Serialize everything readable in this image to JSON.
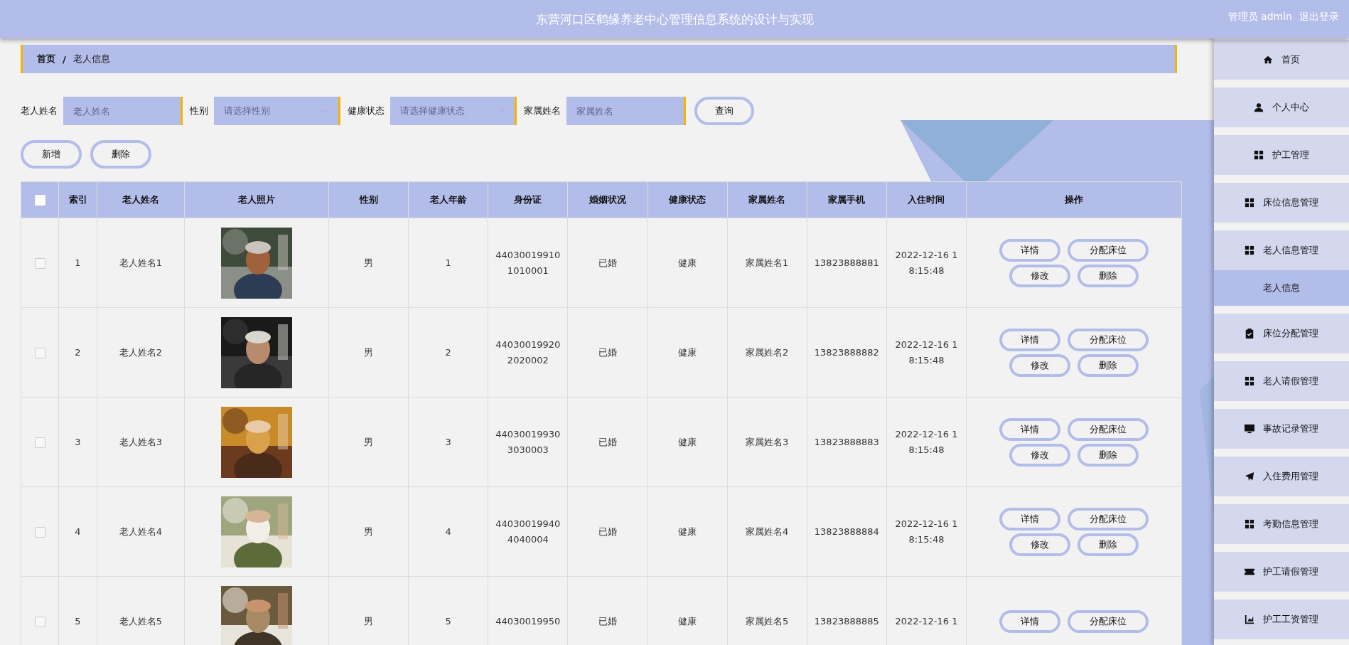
{
  "header": {
    "title": "东营河口区鹤缘养老中心管理信息系统的设计与实现",
    "user": "管理员 admin",
    "logout": "退出登录"
  },
  "breadcrumb": {
    "home": "首页",
    "separator": "/",
    "current": "老人信息"
  },
  "filters": [
    {
      "kind": "input",
      "label": "老人姓名",
      "placeholder": "老人姓名"
    },
    {
      "kind": "select",
      "label": "性别",
      "placeholder": "请选择性别"
    },
    {
      "kind": "select",
      "label": "健康状态",
      "placeholder": "请选择健康状态"
    },
    {
      "kind": "input",
      "label": "家属姓名",
      "placeholder": "家属姓名"
    }
  ],
  "search_button": "查询",
  "actions": [
    "新增",
    "删除"
  ],
  "table": {
    "columns": [
      "索引",
      "老人姓名",
      "老人照片",
      "性别",
      "老人年龄",
      "身份证",
      "婚姻状况",
      "健康状态",
      "家属姓名",
      "家属手机",
      "入住时间",
      "操作"
    ],
    "select_all_checked": false,
    "rows": [
      {
        "checked": false,
        "cells": [
          "1",
          "老人姓名1",
          {
            "kind": "picture"
          },
          "男",
          "1",
          "44030019910\n1010001",
          "已婚",
          "健康",
          "家属姓名1",
          "13823888881",
          "2022-12-16 1\n8:15:48"
        ],
        "actions": [
          "详情",
          "分配床位",
          "修改",
          "删除"
        ]
      },
      {
        "checked": false,
        "cells": [
          "2",
          "老人姓名2",
          {
            "kind": "picture"
          },
          "男",
          "2",
          "44030019920\n2020002",
          "已婚",
          "健康",
          "家属姓名2",
          "13823888882",
          "2022-12-16 1\n8:15:48"
        ],
        "actions": [
          "详情",
          "分配床位",
          "修改",
          "删除"
        ]
      },
      {
        "checked": false,
        "cells": [
          "3",
          "老人姓名3",
          {
            "kind": "picture"
          },
          "男",
          "3",
          "44030019930\n3030003",
          "已婚",
          "健康",
          "家属姓名3",
          "13823888883",
          "2022-12-16 1\n8:15:48"
        ],
        "actions": [
          "详情",
          "分配床位",
          "修改",
          "删除"
        ]
      },
      {
        "checked": false,
        "cells": [
          "4",
          "老人姓名4",
          {
            "kind": "picture"
          },
          "男",
          "4",
          "44030019940\n4040004",
          "已婚",
          "健康",
          "家属姓名4",
          "13823888884",
          "2022-12-16 1\n8:15:48"
        ],
        "actions": [
          "详情",
          "分配床位",
          "修改",
          "删除"
        ]
      },
      {
        "checked": false,
        "cells": [
          "5",
          "老人姓名5",
          {
            "kind": "picture"
          },
          "男",
          "5",
          "44030019950",
          "已婚",
          "健康",
          "家属姓名5",
          "13823888885",
          "2022-12-16 1"
        ],
        "actions": [
          "详情",
          "分配床位"
        ]
      }
    ]
  },
  "sidebar": {
    "items": [
      {
        "label": "首页",
        "selected": false
      },
      {
        "label": "个人中心",
        "selected": false
      },
      {
        "label": "护工管理",
        "selected": false
      },
      {
        "label": "床位信息管理",
        "selected": false
      },
      {
        "label": "老人信息管理",
        "selected": false,
        "children": [
          {
            "label": "老人信息",
            "selected": true
          }
        ]
      },
      {
        "label": "床位分配管理",
        "selected": false
      },
      {
        "label": "老人请假管理",
        "selected": false
      },
      {
        "label": "事故记录管理",
        "selected": false
      },
      {
        "label": "入住费用管理",
        "selected": false
      },
      {
        "label": "考勤信息管理",
        "selected": false
      },
      {
        "label": "护工请假管理",
        "selected": false
      },
      {
        "label": "护工工资管理",
        "selected": false
      }
    ]
  }
}
